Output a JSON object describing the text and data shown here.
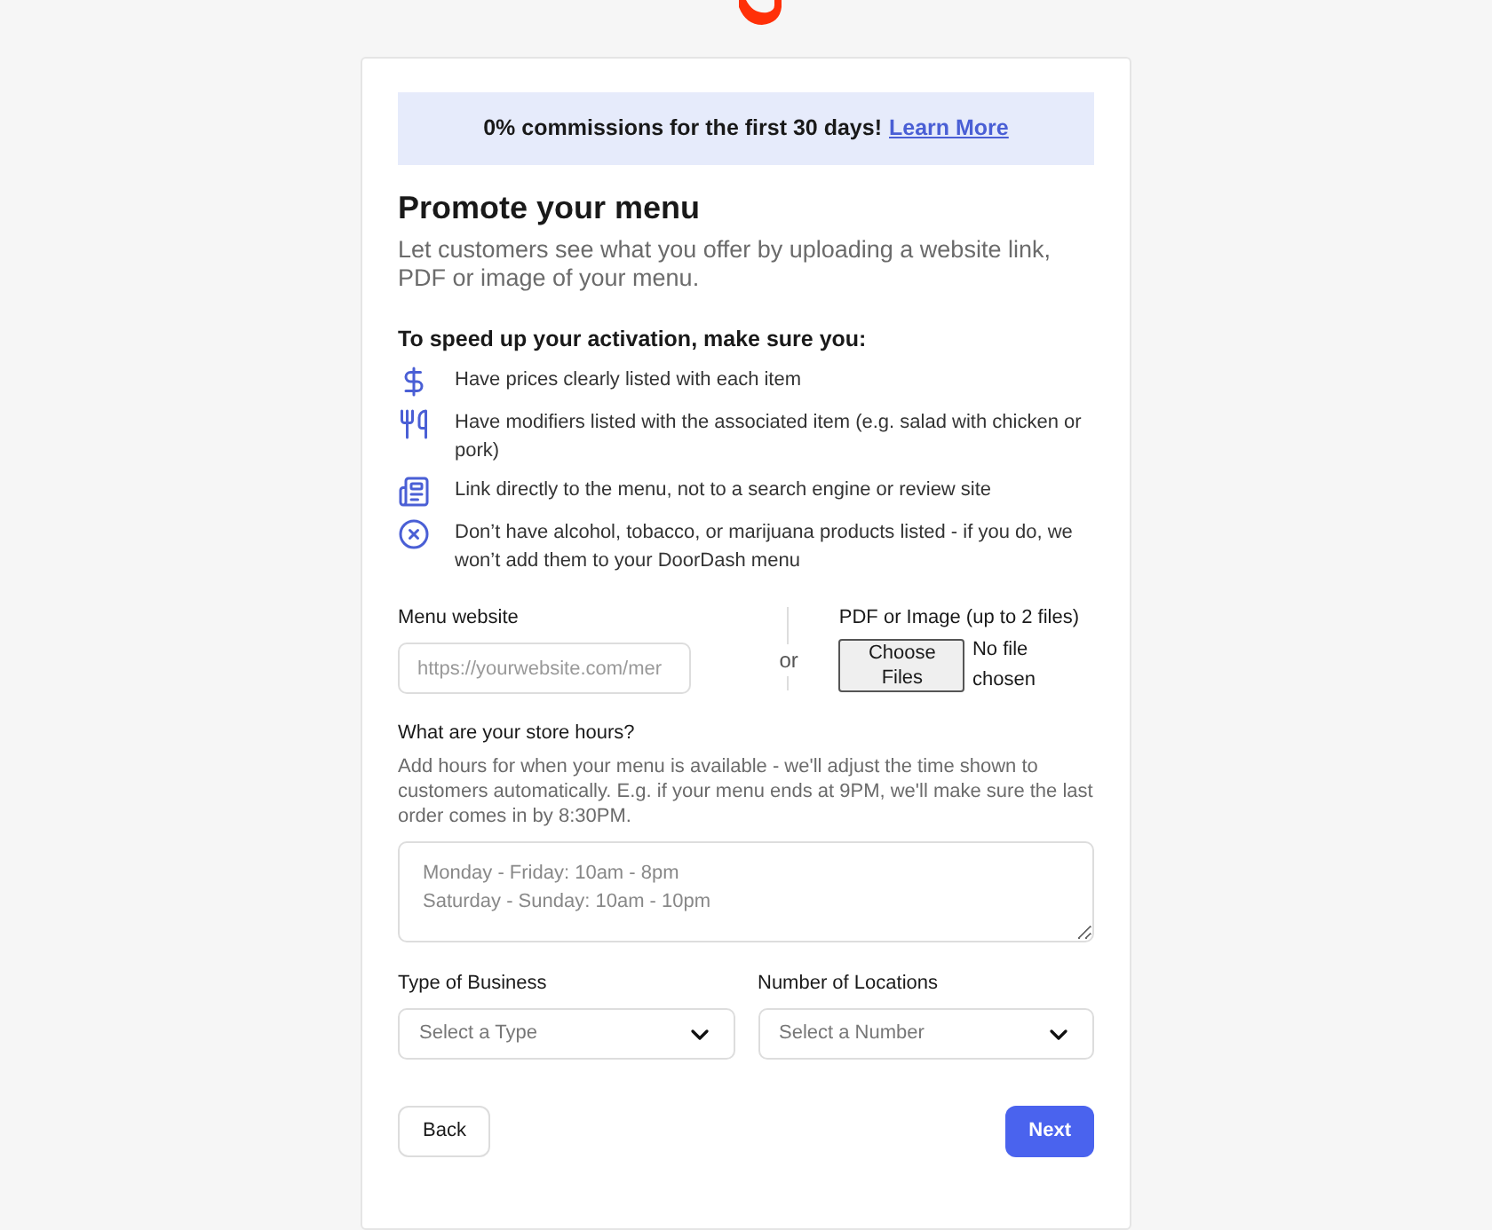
{
  "banner": {
    "text": "0% commissions for the first 30 days!",
    "link": "Learn More"
  },
  "heading": "Promote your menu",
  "description": "Let customers see what you offer by uploading a website link, PDF or image of your menu.",
  "checklist": {
    "title": "To speed up your activation, make sure you:",
    "items": [
      {
        "kind": "dollar",
        "text": "Have prices clearly listed with each item"
      },
      {
        "kind": "utensils",
        "text": "Have modifiers listed with the associated item (e.g. salad with chicken or pork)"
      },
      {
        "kind": "list",
        "text": "Link directly to the menu, not to a search engine or review site"
      },
      {
        "kind": "forbidden",
        "text": "Don’t have alcohol, tobacco, or marijuana products listed - if you do, we won’t add them to your DoorDash menu"
      }
    ]
  },
  "menu_website": {
    "label": "Menu website",
    "placeholder": "https://yourwebsite.com/mer"
  },
  "separator": "or",
  "file_upload": {
    "label": "PDF or Image (up to 2 files)",
    "button": "Choose Files",
    "status": "No file chosen"
  },
  "store_hours": {
    "label": "What are your store hours?",
    "help": "Add hours for when your menu is available - we'll adjust the time shown to customers automatically. E.g. if your menu ends at 9PM, we'll make sure the last order comes in by 8:30PM.",
    "placeholder": "Monday - Friday: 10am - 8pm\nSaturday - Sunday: 10am - 10pm"
  },
  "selects": [
    {
      "label": "Type of Business",
      "placeholder": "Select a Type"
    },
    {
      "label": "Number of Locations",
      "placeholder": "Select a Number"
    }
  ],
  "buttons": {
    "back": "Back",
    "next": "Next"
  }
}
